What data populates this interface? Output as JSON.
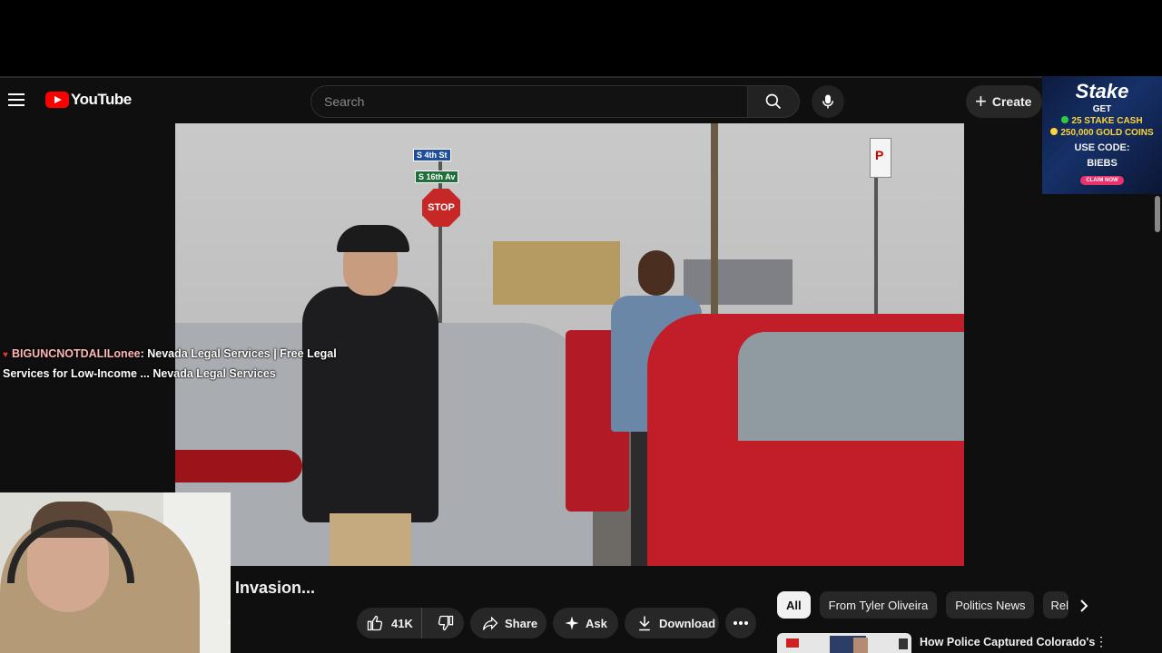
{
  "app": {
    "logo_text": "YouTube"
  },
  "header": {
    "search_placeholder": "Search",
    "create_label": "Create"
  },
  "ad": {
    "brand": "Stake",
    "line1": "GET",
    "line2": "25 STAKE CASH",
    "line3": "250,000 GOLD COINS",
    "code_label": "USE CODE:",
    "code": "BIEBS",
    "claim": "CLAIM NOW"
  },
  "player": {
    "scene_sign_stop": "STOP",
    "street_sign_1": "S 4th St",
    "street_sign_2": "S 16th Av"
  },
  "chat": {
    "user": "BIGUNCNOTDALILonee",
    "message": ": Nevada Legal Services | Free Legal Services for Low-Income ... Nevada Legal Services"
  },
  "video": {
    "title": "Invasion..."
  },
  "actions": {
    "like_count": "41K",
    "share_label": "Share",
    "ask_label": "Ask",
    "download_label": "Download"
  },
  "chips": [
    {
      "label": "All"
    },
    {
      "label": "From Tyler Oliveira"
    },
    {
      "label": "Politics News"
    },
    {
      "label": "Rela"
    }
  ],
  "recommendation": {
    "title": "How Police Captured Colorado's"
  }
}
